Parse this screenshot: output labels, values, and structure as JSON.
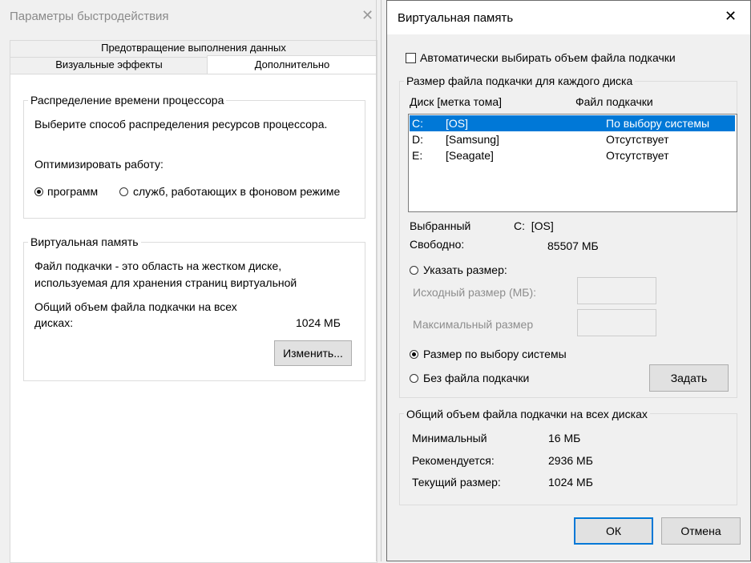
{
  "perf_window": {
    "title": "Параметры быстродействия",
    "close_glyph": "✕",
    "tabs": {
      "dep": "Предотвращение выполнения данных",
      "visual": "Визуальные эффекты",
      "advanced": "Дополнительно"
    },
    "cpu_group": {
      "caption": "Распределение времени процессора",
      "description": "Выберите способ распределения ресурсов процессора.",
      "optimize_label": "Оптимизировать работу:",
      "option_programs": "программ",
      "option_services": "служб, работающих в фоновом режиме",
      "selected": "programs"
    },
    "vm_group": {
      "caption": "Виртуальная память",
      "description_line1": "Файл подкачки - это область на жестком диске,",
      "description_line2": "используемая для хранения страниц виртуальной",
      "total_line1": "Общий объем файла подкачки на всех",
      "total_line2": "дисках:",
      "total_value": "1024 МБ",
      "change_button": "Изменить..."
    }
  },
  "vm_dialog": {
    "title": "Виртуальная память",
    "close_glyph": "✕",
    "auto_checkbox_label": "Автоматически выбирать объем файла подкачки",
    "auto_checked": false,
    "per_disk_caption": "Размер файла подкачки для каждого диска",
    "columns": {
      "disk": "Диск [метка тома]",
      "pagefile": "Файл подкачки"
    },
    "drives": [
      {
        "letter": "C:",
        "label": "[OS]",
        "pagefile": "По выбору системы",
        "selected": true
      },
      {
        "letter": "D:",
        "label": "[Samsung]",
        "pagefile": "Отсутствует",
        "selected": false
      },
      {
        "letter": "E:",
        "label": "[Seagate]",
        "pagefile": "Отсутствует",
        "selected": false
      }
    ],
    "selected_label": "Выбранный",
    "selected_value": "C:  [OS]",
    "free_label": "Свободно:",
    "free_value": "85507 МБ",
    "custom_size_label": "Указать размер:",
    "initial_size_label": "Исходный размер (МБ):",
    "max_size_label": "Максимальный размер",
    "initial_size_value": "",
    "max_size_value": "",
    "system_managed_label": "Размер по выбору системы",
    "no_pagefile_label": "Без файла подкачки",
    "size_mode": "system",
    "set_button": "Задать",
    "totals_caption": "Общий объем файла подкачки на всех дисках",
    "minimum_label": "Минимальный",
    "minimum_value": "16 МБ",
    "recommended_label": "Рекомендуется:",
    "recommended_value": "2936 МБ",
    "current_label": "Текущий размер:",
    "current_value": "1024 МБ",
    "ok_button": "ОК",
    "cancel_button": "Отмена"
  },
  "colors": {
    "accent": "#0078d7",
    "window_bg": "#f0f0f0",
    "panel_bg": "#ffffff",
    "disabled_text": "#8d8d8d"
  }
}
